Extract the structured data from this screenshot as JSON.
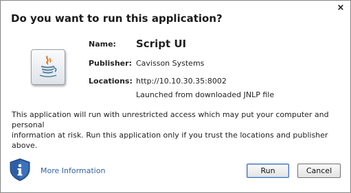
{
  "dialog": {
    "title": "Do you want to run this application?",
    "close_label": "×"
  },
  "app": {
    "icon": "java-icon",
    "name_label": "Name:",
    "name_value": "Script UI",
    "publisher_label": "Publisher:",
    "publisher_value": "Cavisson Systems",
    "locations_label": "Locations:",
    "locations_value": "http://10.10.30.35:8002",
    "locations_note": "Launched from downloaded JNLP file"
  },
  "warning": {
    "line1": "This application will run with unrestricted access which may put your computer and personal",
    "line2": "information at risk. Run this application only if you trust the locations and publisher above."
  },
  "footer": {
    "info_icon": "shield-info-icon",
    "more_info_label": "More Information",
    "run_label": "Run",
    "cancel_label": "Cancel"
  },
  "colors": {
    "link": "#31639f",
    "shield": "#2d5fa6",
    "default_button_border": "#3f6fb0"
  }
}
